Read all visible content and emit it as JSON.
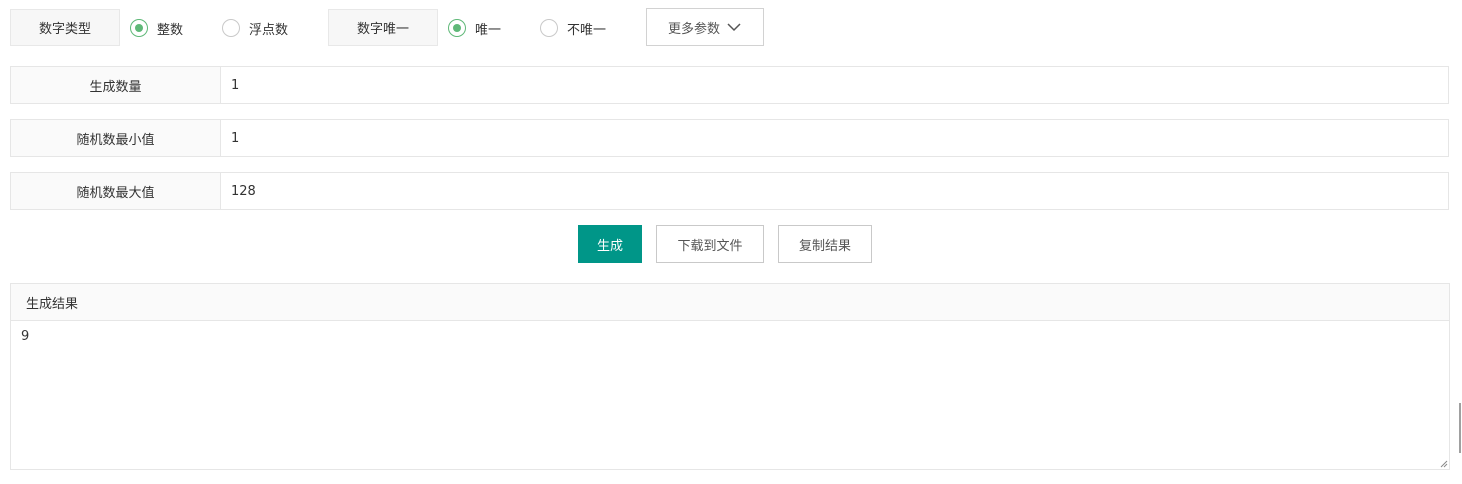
{
  "type_group": {
    "label": "数字类型",
    "options": [
      {
        "label": "整数",
        "checked": true
      },
      {
        "label": "浮点数",
        "checked": false
      }
    ]
  },
  "unique_group": {
    "label": "数字唯一",
    "options": [
      {
        "label": "唯一",
        "checked": true
      },
      {
        "label": "不唯一",
        "checked": false
      }
    ]
  },
  "more_params": {
    "label": "更多参数",
    "icon": "chevron-down-icon"
  },
  "fields": {
    "count": {
      "label": "生成数量",
      "value": "1"
    },
    "min": {
      "label": "随机数最小值",
      "value": "1"
    },
    "max": {
      "label": "随机数最大值",
      "value": "128"
    }
  },
  "actions": {
    "generate": "生成",
    "download": "下载到文件",
    "copy": "复制结果"
  },
  "result": {
    "title": "生成结果",
    "value": "9"
  },
  "colors": {
    "primary": "#009688",
    "radio_checked": "#5fb878"
  }
}
